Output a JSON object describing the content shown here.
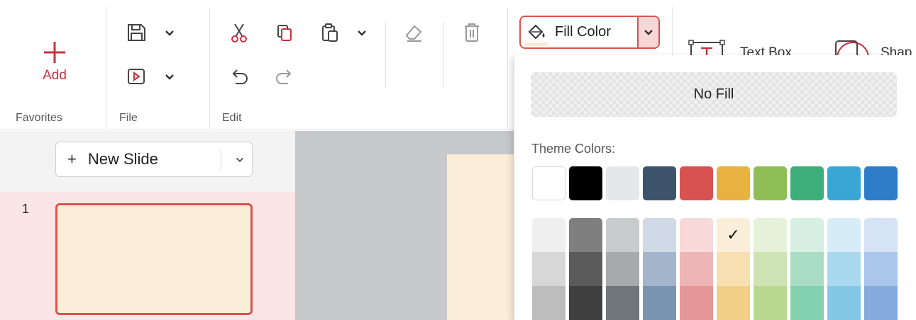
{
  "ribbon": {
    "favorites": {
      "add_label": "Add",
      "group_label": "Favorites"
    },
    "file": {
      "group_label": "File"
    },
    "edit": {
      "group_label": "Edit"
    },
    "fill_color": {
      "label": "Fill Color",
      "current_color": "#fbe9d5"
    },
    "insert": {
      "text_box_label": "Text Box",
      "shape_label": "Shap"
    }
  },
  "slides_panel": {
    "new_slide_label": "New Slide",
    "slides": [
      {
        "number": "1",
        "background": "#fbeed9",
        "selected": true
      }
    ]
  },
  "fill_dropdown": {
    "no_fill_label": "No Fill",
    "theme_colors_label": "Theme Colors:",
    "theme_colors": [
      "#ffffff",
      "#000000",
      "#e6e7e8",
      "#3d536b",
      "#d65352",
      "#e8b241",
      "#8fbe57",
      "#3cae7a",
      "#3aa6d6",
      "#2f7cc9"
    ],
    "shades": [
      [
        "#efefef",
        "#d7d7d7",
        "#bdbdbd"
      ],
      [
        "#7f7f7f",
        "#5b5b5b",
        "#3f3f3f"
      ],
      [
        "#c9cbcd",
        "#a7aaad",
        "#70757a"
      ],
      [
        "#d0dae6",
        "#a3b6cc",
        "#7894b1"
      ],
      [
        "#f6d9d8",
        "#edb5b5",
        "#e39796"
      ],
      [
        "#fbeed9",
        "#f6dfb0",
        "#f0cf87"
      ],
      [
        "#e5f1d9",
        "#cde3b3",
        "#b7d88e"
      ],
      [
        "#d7efe3",
        "#a9ddc3",
        "#84d1b0"
      ],
      [
        "#d6ecf7",
        "#a9d9ee",
        "#84c6e6"
      ],
      [
        "#d5e3f4",
        "#abc6eb",
        "#86abdd"
      ]
    ],
    "selected_shade": {
      "column": 5,
      "row": 0
    },
    "check_glyph": "✓"
  }
}
